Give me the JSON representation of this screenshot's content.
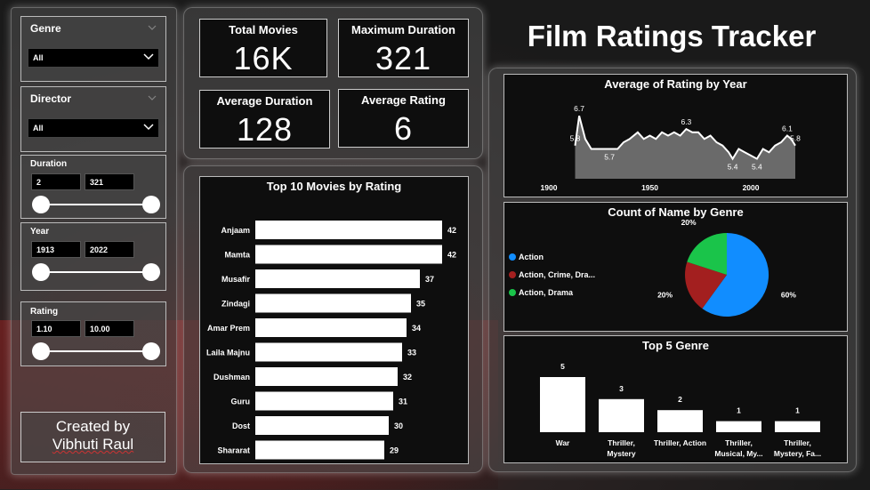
{
  "filters": {
    "genre": {
      "label": "Genre",
      "value": "All"
    },
    "director": {
      "label": "Director",
      "value": "All"
    },
    "duration": {
      "label": "Duration",
      "min": "2",
      "max": "321"
    },
    "year": {
      "label": "Year",
      "min": "1913",
      "max": "2022"
    },
    "rating": {
      "label": "Rating",
      "min": "1.10",
      "max": "10.00"
    }
  },
  "kpis": [
    {
      "label": "Total Movies",
      "value": "16K"
    },
    {
      "label": "Maximum Duration",
      "value": "321"
    },
    {
      "label": "Average Duration",
      "value": "128"
    },
    {
      "label": "Average Rating",
      "value": "6"
    }
  ],
  "dashboard_title": "Film Ratings Tracker",
  "credit": {
    "line1": "Created by",
    "line2": "Vibhuti Raul"
  },
  "chart_data": [
    {
      "type": "bar",
      "orientation": "horizontal",
      "title": "Top 10 Movies by Rating",
      "categories": [
        "Anjaam",
        "Mamta",
        "Musafir",
        "Zindagi",
        "Amar Prem",
        "Laila Majnu",
        "Dushman",
        "Guru",
        "Dost",
        "Shararat"
      ],
      "values": [
        42,
        42,
        37,
        35,
        34,
        33,
        32,
        31,
        30,
        29
      ],
      "xlim": [
        0,
        42
      ],
      "color": "#ffffff"
    },
    {
      "type": "area",
      "title": "Average of Rating by Year",
      "x_ticks": [
        "1900",
        "1950",
        "2000"
      ],
      "xlim": [
        1900,
        2022
      ],
      "ylim": [
        4.8,
        7.0
      ],
      "points": [
        [
          1913,
          5.8
        ],
        [
          1915,
          6.7
        ],
        [
          1918,
          6.0
        ],
        [
          1921,
          5.7
        ],
        [
          1925,
          5.7
        ],
        [
          1930,
          5.7
        ],
        [
          1934,
          5.7
        ],
        [
          1937,
          5.9
        ],
        [
          1940,
          6.0
        ],
        [
          1944,
          6.2
        ],
        [
          1947,
          6.0
        ],
        [
          1950,
          6.1
        ],
        [
          1953,
          6.0
        ],
        [
          1956,
          6.2
        ],
        [
          1959,
          6.1
        ],
        [
          1962,
          6.2
        ],
        [
          1965,
          6.1
        ],
        [
          1968,
          6.3
        ],
        [
          1971,
          6.2
        ],
        [
          1974,
          6.2
        ],
        [
          1977,
          6.0
        ],
        [
          1980,
          6.1
        ],
        [
          1983,
          5.9
        ],
        [
          1986,
          5.8
        ],
        [
          1989,
          5.6
        ],
        [
          1991,
          5.4
        ],
        [
          1994,
          5.7
        ],
        [
          1997,
          5.6
        ],
        [
          2000,
          5.5
        ],
        [
          2003,
          5.4
        ],
        [
          2006,
          5.7
        ],
        [
          2009,
          5.6
        ],
        [
          2012,
          5.8
        ],
        [
          2015,
          5.9
        ],
        [
          2018,
          6.1
        ],
        [
          2020,
          6.0
        ],
        [
          2022,
          5.8
        ]
      ],
      "data_labels": [
        {
          "year": 1913,
          "value": "5.8"
        },
        {
          "year": 1915,
          "value": "6.7"
        },
        {
          "year": 1930,
          "value": "5.7"
        },
        {
          "year": 1968,
          "value": "6.3"
        },
        {
          "year": 1991,
          "value": "5.4"
        },
        {
          "year": 2003,
          "value": "5.4"
        },
        {
          "year": 2018,
          "value": "6.1"
        },
        {
          "year": 2022,
          "value": "5.8"
        }
      ]
    },
    {
      "type": "pie",
      "title": "Count of Name by Genre",
      "legend_position": "left",
      "slices": [
        {
          "name": "Action",
          "value": 60,
          "label": "60%",
          "color": "#118dff"
        },
        {
          "name": "Action, Crime, Dra...",
          "value": 20,
          "label": "20%",
          "color": "#a31f1f"
        },
        {
          "name": "Action, Drama",
          "value": 20,
          "label": "20%",
          "color": "#1ac44a"
        }
      ]
    },
    {
      "type": "bar",
      "title": "Top 5 Genre",
      "categories": [
        "War",
        "Thriller, Mystery",
        "Thriller, Action",
        "Thriller, Musical, My...",
        "Thriller, Mystery, Fa..."
      ],
      "category_lines": [
        [
          "War"
        ],
        [
          "Thriller,",
          "Mystery"
        ],
        [
          "Thriller, Action"
        ],
        [
          "Thriller,",
          "Musical, My..."
        ],
        [
          "Thriller,",
          "Mystery, Fa..."
        ]
      ],
      "values": [
        5,
        3,
        2,
        1,
        1
      ],
      "ylim": [
        0,
        5
      ],
      "color": "#ffffff"
    }
  ]
}
